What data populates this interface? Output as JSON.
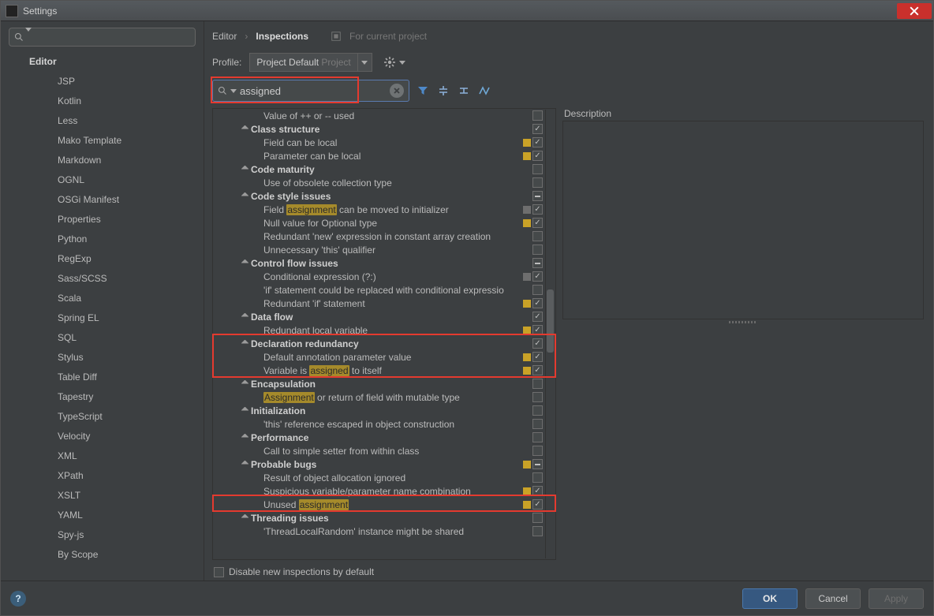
{
  "window": {
    "title": "Settings"
  },
  "sidebar": {
    "heading": "Editor",
    "items": [
      "JSP",
      "Kotlin",
      "Less",
      "Mako Template",
      "Markdown",
      "OGNL",
      "OSGi Manifest",
      "Properties",
      "Python",
      "RegExp",
      "Sass/SCSS",
      "Scala",
      "Spring EL",
      "SQL",
      "Stylus",
      "Table Diff",
      "Tapestry",
      "TypeScript",
      "Velocity",
      "XML",
      "XPath",
      "XSLT",
      "YAML",
      "Spy-js",
      "By Scope"
    ]
  },
  "breadcrumb": {
    "root": "Editor",
    "leaf": "Inspections",
    "note": "For current project"
  },
  "profile": {
    "label": "Profile:",
    "name": "Project Default",
    "scope": "Project"
  },
  "filter": {
    "search": "assigned"
  },
  "description_label": "Description",
  "disable_label": "Disable new inspections by default",
  "buttons": {
    "ok": "OK",
    "cancel": "Cancel",
    "apply": "Apply"
  },
  "tree": [
    {
      "type": "leaf",
      "indent": 3,
      "text": "Value of ++ or -- used",
      "sev": null,
      "check": "none"
    },
    {
      "type": "group",
      "indent": 2,
      "text": "Class structure",
      "check": "checked"
    },
    {
      "type": "leaf",
      "indent": 3,
      "text": "Field can be local",
      "sev": "y",
      "check": "checked"
    },
    {
      "type": "leaf",
      "indent": 3,
      "text": "Parameter can be local",
      "sev": "y",
      "check": "checked"
    },
    {
      "type": "group",
      "indent": 2,
      "text": "Code maturity",
      "check": "none"
    },
    {
      "type": "leaf",
      "indent": 3,
      "text": "Use of obsolete collection type",
      "sev": null,
      "check": "none"
    },
    {
      "type": "group",
      "indent": 2,
      "text": "Code style issues",
      "check": "mixed"
    },
    {
      "type": "leaf",
      "indent": 3,
      "parts": [
        "Field ",
        {
          "hl": "assignment"
        },
        " can be moved to initializer"
      ],
      "sev": "g",
      "check": "checked"
    },
    {
      "type": "leaf",
      "indent": 3,
      "text": "Null value for Optional type",
      "sev": "y",
      "check": "checked"
    },
    {
      "type": "leaf",
      "indent": 3,
      "text": "Redundant 'new' expression in constant array creation",
      "sev": null,
      "check": "none"
    },
    {
      "type": "leaf",
      "indent": 3,
      "text": "Unnecessary 'this' qualifier",
      "sev": null,
      "check": "none"
    },
    {
      "type": "group",
      "indent": 2,
      "text": "Control flow issues",
      "check": "mixed"
    },
    {
      "type": "leaf",
      "indent": 3,
      "text": "Conditional expression (?:)",
      "sev": "g",
      "check": "checked"
    },
    {
      "type": "leaf",
      "indent": 3,
      "text": "'if' statement could be replaced with conditional expressio",
      "sev": null,
      "check": "none"
    },
    {
      "type": "leaf",
      "indent": 3,
      "text": "Redundant 'if' statement",
      "sev": "y",
      "check": "checked"
    },
    {
      "type": "group",
      "indent": 2,
      "text": "Data flow",
      "check": "checked"
    },
    {
      "type": "leaf",
      "indent": 3,
      "text": "Redundant local variable",
      "sev": "y",
      "check": "checked"
    },
    {
      "type": "group",
      "indent": 2,
      "text": "Declaration redundancy",
      "check": "checked"
    },
    {
      "type": "leaf",
      "indent": 3,
      "text": "Default annotation parameter value",
      "sev": "y",
      "check": "checked"
    },
    {
      "type": "leaf",
      "indent": 3,
      "parts": [
        "Variable is ",
        {
          "hl": "assigned"
        },
        " to itself"
      ],
      "sev": "y",
      "check": "checked"
    },
    {
      "type": "group",
      "indent": 2,
      "text": "Encapsulation",
      "check": "none"
    },
    {
      "type": "leaf",
      "indent": 3,
      "parts": [
        {
          "hl": "Assignment"
        },
        " or return of field with mutable type"
      ],
      "sev": null,
      "check": "none"
    },
    {
      "type": "group",
      "indent": 2,
      "text": "Initialization",
      "check": "none"
    },
    {
      "type": "leaf",
      "indent": 3,
      "text": "'this' reference escaped in object construction",
      "sev": null,
      "check": "none"
    },
    {
      "type": "group",
      "indent": 2,
      "text": "Performance",
      "check": "none"
    },
    {
      "type": "leaf",
      "indent": 3,
      "text": "Call to simple setter from within class",
      "sev": null,
      "check": "none"
    },
    {
      "type": "group",
      "indent": 2,
      "text": "Probable bugs",
      "sev": "y",
      "check": "mixed"
    },
    {
      "type": "leaf",
      "indent": 3,
      "text": "Result of object allocation ignored",
      "sev": null,
      "check": "none"
    },
    {
      "type": "leaf",
      "indent": 3,
      "text": "Suspicious variable/parameter name combination",
      "sev": "y",
      "check": "checked"
    },
    {
      "type": "leaf",
      "indent": 3,
      "parts": [
        "Unused ",
        {
          "hl": "assignment"
        }
      ],
      "sev": "y",
      "check": "checked"
    },
    {
      "type": "group",
      "indent": 2,
      "text": "Threading issues",
      "check": "none"
    },
    {
      "type": "leaf",
      "indent": 3,
      "text": "'ThreadLocalRandom' instance might be shared",
      "sev": null,
      "check": "none"
    }
  ]
}
